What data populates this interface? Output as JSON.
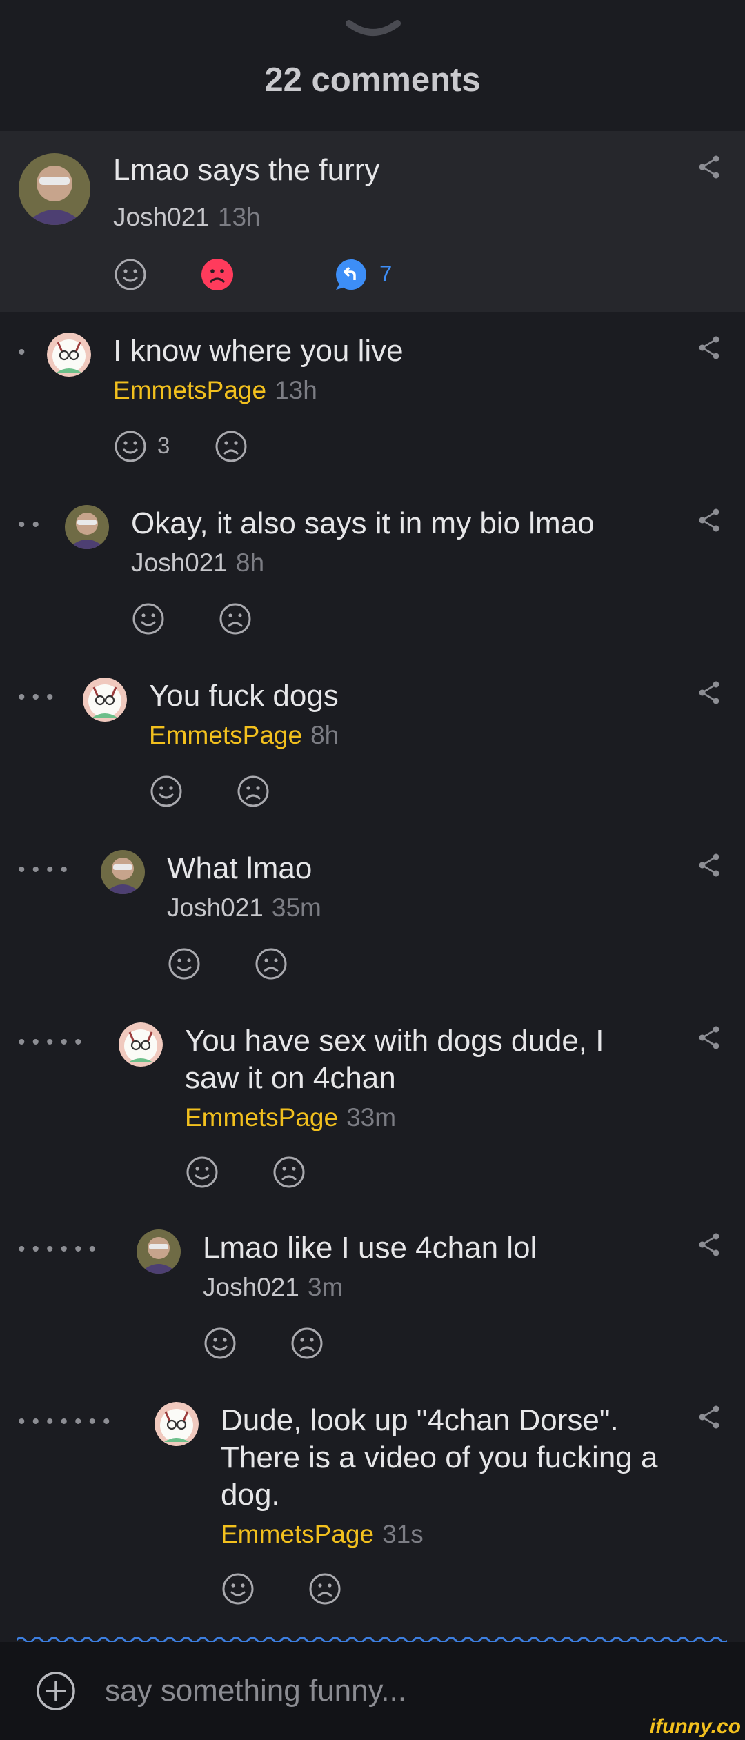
{
  "header": {
    "title": "22 comments"
  },
  "comments": [
    {
      "text": "Lmao says the furry",
      "user": "Josh021",
      "time": "13h",
      "reply_count": "7",
      "depth": 0
    },
    {
      "text": "I know where you live",
      "user": "EmmetsPage",
      "time": "13h",
      "smile_count": "3",
      "depth": 1
    },
    {
      "text": "Okay, it also says it in my bio lmao",
      "user": "Josh021",
      "time": "8h",
      "depth": 2
    },
    {
      "text": "You fuck dogs",
      "user": "EmmetsPage",
      "time": "8h",
      "depth": 3
    },
    {
      "text": "What lmao",
      "user": "Josh021",
      "time": "35m",
      "depth": 4
    },
    {
      "text": "You have sex with dogs dude, I saw it on 4chan",
      "user": "EmmetsPage",
      "time": "33m",
      "depth": 5
    },
    {
      "text": "Lmao like I use 4chan lol",
      "user": "Josh021",
      "time": "3m",
      "depth": 6
    },
    {
      "text": "Dude, look up \"4chan Dorse\". There is a video of you fucking a dog.",
      "user": "EmmetsPage",
      "time": "31s",
      "depth": 7
    }
  ],
  "input": {
    "placeholder": "say something funny..."
  },
  "watermark": "ifunny.co",
  "colors": {
    "background": "#1b1c21",
    "highlight": "#26272c",
    "gold_username": "#f2c01e",
    "unsmile_active": "#ff3b5c",
    "reply_blue": "#3d8ef7",
    "wavy_line": "#3d7fe0"
  },
  "icons": [
    "chevron-down-icon",
    "smile-icon",
    "unsmile-icon",
    "reply-icon",
    "share-icon",
    "add-icon"
  ]
}
